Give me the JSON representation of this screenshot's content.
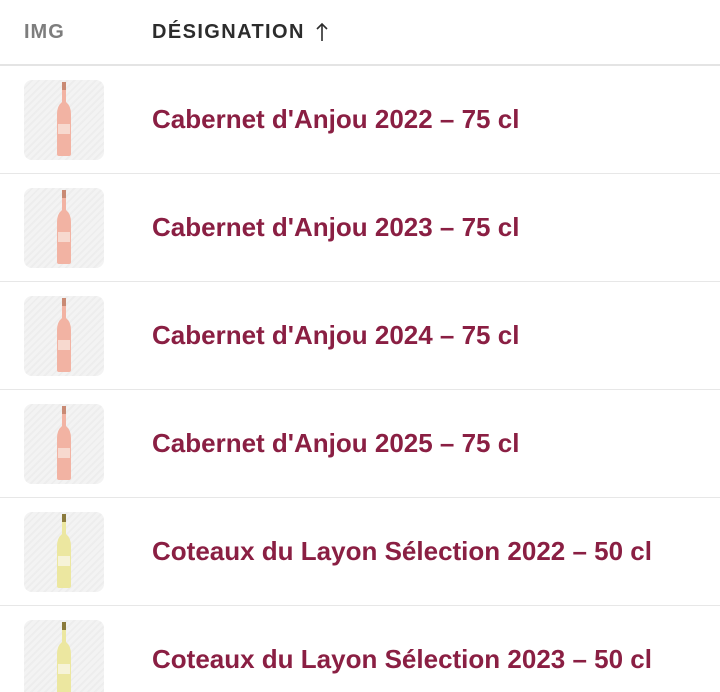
{
  "table": {
    "columns": {
      "img": "IMG",
      "designation": "DÉSIGNATION",
      "sort_indicator": "↑"
    },
    "rows": [
      {
        "name": "Cabernet d'Anjou 2022 – 75 cl",
        "bottle": "rose"
      },
      {
        "name": "Cabernet d'Anjou 2023 – 75 cl",
        "bottle": "rose"
      },
      {
        "name": "Cabernet d'Anjou 2024 – 75 cl",
        "bottle": "rose"
      },
      {
        "name": "Cabernet d'Anjou 2025 – 75 cl",
        "bottle": "rose"
      },
      {
        "name": "Coteaux du Layon Sélection 2022 – 50 cl",
        "bottle": "white"
      },
      {
        "name": "Coteaux du Layon Sélection 2023 – 50 cl",
        "bottle": "white"
      }
    ]
  },
  "colors": {
    "link": "#8a1f43",
    "rose_wine": "#f2b3a3",
    "white_wine": "#ece7a0"
  }
}
